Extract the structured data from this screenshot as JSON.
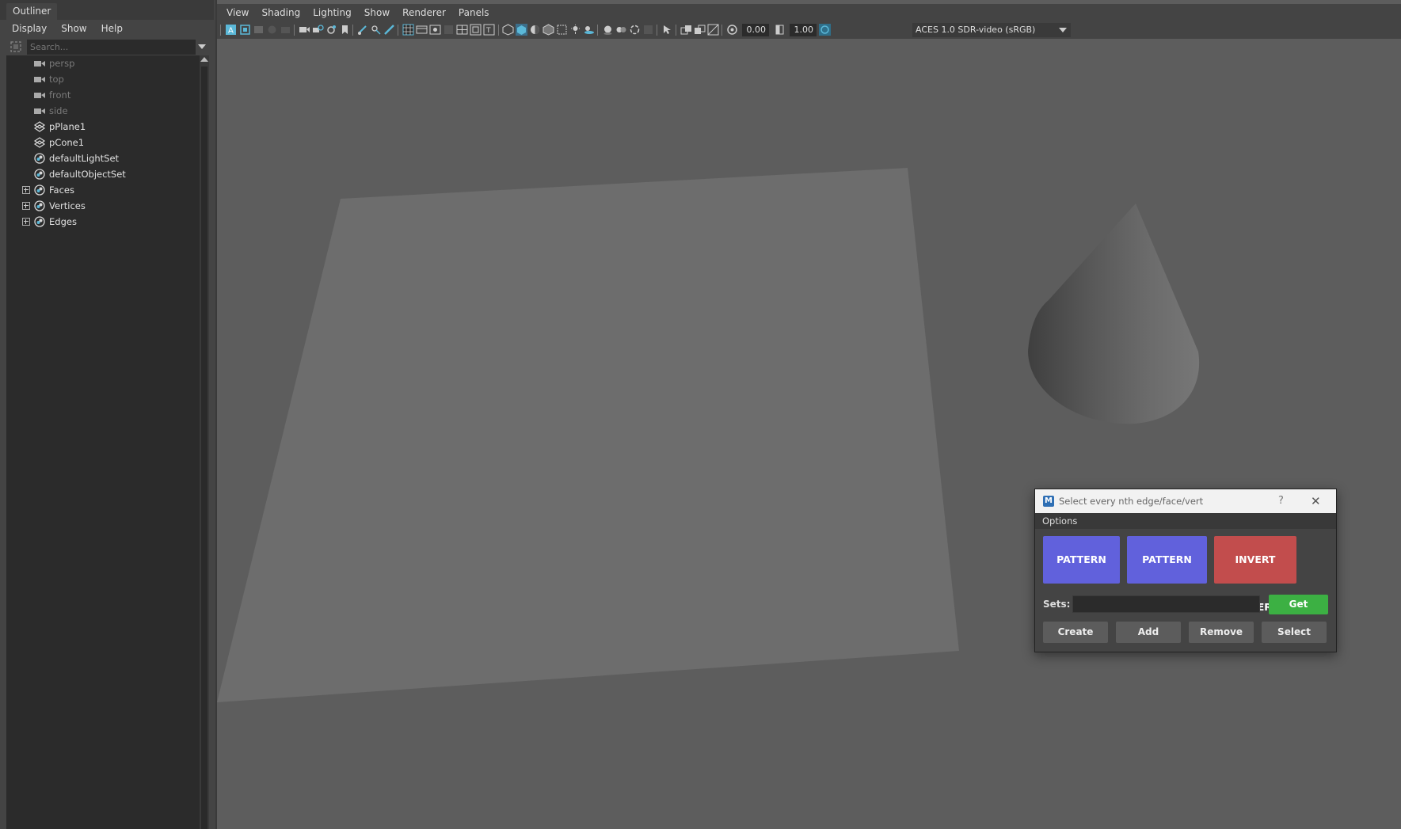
{
  "outliner": {
    "title": "Outliner",
    "menu": [
      "Display",
      "Show",
      "Help"
    ],
    "search_placeholder": "Search...",
    "items": [
      {
        "label": "persp",
        "icon": "camera-icon",
        "dim": true,
        "expandable": false
      },
      {
        "label": "top",
        "icon": "camera-icon",
        "dim": true,
        "expandable": false
      },
      {
        "label": "front",
        "icon": "camera-icon",
        "dim": true,
        "expandable": false
      },
      {
        "label": "side",
        "icon": "camera-icon",
        "dim": true,
        "expandable": false
      },
      {
        "label": "pPlane1",
        "icon": "mesh-transform-icon",
        "dim": false,
        "expandable": false
      },
      {
        "label": "pCone1",
        "icon": "mesh-transform-icon",
        "dim": false,
        "expandable": false
      },
      {
        "label": "defaultLightSet",
        "icon": "set-icon",
        "dim": false,
        "expandable": false
      },
      {
        "label": "defaultObjectSet",
        "icon": "set-icon",
        "dim": false,
        "expandable": false
      },
      {
        "label": "Faces",
        "icon": "set-icon",
        "dim": false,
        "expandable": true
      },
      {
        "label": "Vertices",
        "icon": "set-icon",
        "dim": false,
        "expandable": true
      },
      {
        "label": "Edges",
        "icon": "set-icon",
        "dim": false,
        "expandable": true
      }
    ]
  },
  "viewport": {
    "menu": [
      "View",
      "Shading",
      "Lighting",
      "Show",
      "Renderer",
      "Panels"
    ],
    "exposure": "0.00",
    "gamma": "1.00",
    "color_space": "ACES 1.0 SDR-video (sRGB)"
  },
  "dialog": {
    "title": "Select every nth edge/face/vert",
    "help_glyph": "?",
    "close_glyph": "✕",
    "menu_label": "Options",
    "pattern_label": "PATTERN",
    "pattern_range_label": "PATTERN RANGE",
    "invert_pattern_label": "INVERT PATTERN",
    "sets_label": "Sets:",
    "sets_value": "",
    "get_label": "Get",
    "create_label": "Create",
    "add_label": "Add",
    "remove_label": "Remove",
    "select_label": "Select"
  },
  "colors": {
    "pattern": "#6161dc",
    "pattern_range": "#6161dc",
    "invert_pattern": "#c24d4d",
    "get": "#3cb043",
    "viewport_bg": "#5d5d5d",
    "accent": "#5bb8d8"
  }
}
